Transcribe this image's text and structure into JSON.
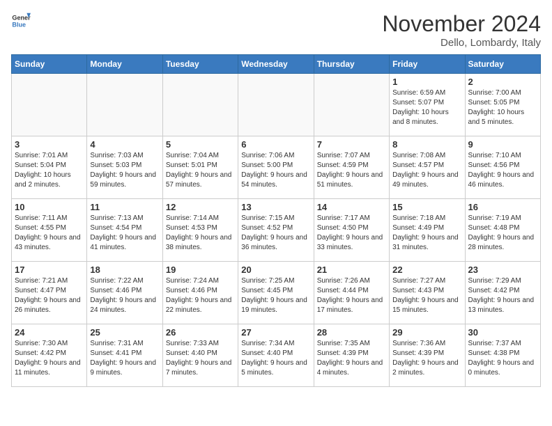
{
  "header": {
    "logo_general": "General",
    "logo_blue": "Blue",
    "month_title": "November 2024",
    "location": "Dello, Lombardy, Italy"
  },
  "days_of_week": [
    "Sunday",
    "Monday",
    "Tuesday",
    "Wednesday",
    "Thursday",
    "Friday",
    "Saturday"
  ],
  "weeks": [
    [
      {
        "day": "",
        "info": ""
      },
      {
        "day": "",
        "info": ""
      },
      {
        "day": "",
        "info": ""
      },
      {
        "day": "",
        "info": ""
      },
      {
        "day": "",
        "info": ""
      },
      {
        "day": "1",
        "info": "Sunrise: 6:59 AM\nSunset: 5:07 PM\nDaylight: 10 hours and 8 minutes."
      },
      {
        "day": "2",
        "info": "Sunrise: 7:00 AM\nSunset: 5:05 PM\nDaylight: 10 hours and 5 minutes."
      }
    ],
    [
      {
        "day": "3",
        "info": "Sunrise: 7:01 AM\nSunset: 5:04 PM\nDaylight: 10 hours and 2 minutes."
      },
      {
        "day": "4",
        "info": "Sunrise: 7:03 AM\nSunset: 5:03 PM\nDaylight: 9 hours and 59 minutes."
      },
      {
        "day": "5",
        "info": "Sunrise: 7:04 AM\nSunset: 5:01 PM\nDaylight: 9 hours and 57 minutes."
      },
      {
        "day": "6",
        "info": "Sunrise: 7:06 AM\nSunset: 5:00 PM\nDaylight: 9 hours and 54 minutes."
      },
      {
        "day": "7",
        "info": "Sunrise: 7:07 AM\nSunset: 4:59 PM\nDaylight: 9 hours and 51 minutes."
      },
      {
        "day": "8",
        "info": "Sunrise: 7:08 AM\nSunset: 4:57 PM\nDaylight: 9 hours and 49 minutes."
      },
      {
        "day": "9",
        "info": "Sunrise: 7:10 AM\nSunset: 4:56 PM\nDaylight: 9 hours and 46 minutes."
      }
    ],
    [
      {
        "day": "10",
        "info": "Sunrise: 7:11 AM\nSunset: 4:55 PM\nDaylight: 9 hours and 43 minutes."
      },
      {
        "day": "11",
        "info": "Sunrise: 7:13 AM\nSunset: 4:54 PM\nDaylight: 9 hours and 41 minutes."
      },
      {
        "day": "12",
        "info": "Sunrise: 7:14 AM\nSunset: 4:53 PM\nDaylight: 9 hours and 38 minutes."
      },
      {
        "day": "13",
        "info": "Sunrise: 7:15 AM\nSunset: 4:52 PM\nDaylight: 9 hours and 36 minutes."
      },
      {
        "day": "14",
        "info": "Sunrise: 7:17 AM\nSunset: 4:50 PM\nDaylight: 9 hours and 33 minutes."
      },
      {
        "day": "15",
        "info": "Sunrise: 7:18 AM\nSunset: 4:49 PM\nDaylight: 9 hours and 31 minutes."
      },
      {
        "day": "16",
        "info": "Sunrise: 7:19 AM\nSunset: 4:48 PM\nDaylight: 9 hours and 28 minutes."
      }
    ],
    [
      {
        "day": "17",
        "info": "Sunrise: 7:21 AM\nSunset: 4:47 PM\nDaylight: 9 hours and 26 minutes."
      },
      {
        "day": "18",
        "info": "Sunrise: 7:22 AM\nSunset: 4:46 PM\nDaylight: 9 hours and 24 minutes."
      },
      {
        "day": "19",
        "info": "Sunrise: 7:24 AM\nSunset: 4:46 PM\nDaylight: 9 hours and 22 minutes."
      },
      {
        "day": "20",
        "info": "Sunrise: 7:25 AM\nSunset: 4:45 PM\nDaylight: 9 hours and 19 minutes."
      },
      {
        "day": "21",
        "info": "Sunrise: 7:26 AM\nSunset: 4:44 PM\nDaylight: 9 hours and 17 minutes."
      },
      {
        "day": "22",
        "info": "Sunrise: 7:27 AM\nSunset: 4:43 PM\nDaylight: 9 hours and 15 minutes."
      },
      {
        "day": "23",
        "info": "Sunrise: 7:29 AM\nSunset: 4:42 PM\nDaylight: 9 hours and 13 minutes."
      }
    ],
    [
      {
        "day": "24",
        "info": "Sunrise: 7:30 AM\nSunset: 4:42 PM\nDaylight: 9 hours and 11 minutes."
      },
      {
        "day": "25",
        "info": "Sunrise: 7:31 AM\nSunset: 4:41 PM\nDaylight: 9 hours and 9 minutes."
      },
      {
        "day": "26",
        "info": "Sunrise: 7:33 AM\nSunset: 4:40 PM\nDaylight: 9 hours and 7 minutes."
      },
      {
        "day": "27",
        "info": "Sunrise: 7:34 AM\nSunset: 4:40 PM\nDaylight: 9 hours and 5 minutes."
      },
      {
        "day": "28",
        "info": "Sunrise: 7:35 AM\nSunset: 4:39 PM\nDaylight: 9 hours and 4 minutes."
      },
      {
        "day": "29",
        "info": "Sunrise: 7:36 AM\nSunset: 4:39 PM\nDaylight: 9 hours and 2 minutes."
      },
      {
        "day": "30",
        "info": "Sunrise: 7:37 AM\nSunset: 4:38 PM\nDaylight: 9 hours and 0 minutes."
      }
    ]
  ]
}
